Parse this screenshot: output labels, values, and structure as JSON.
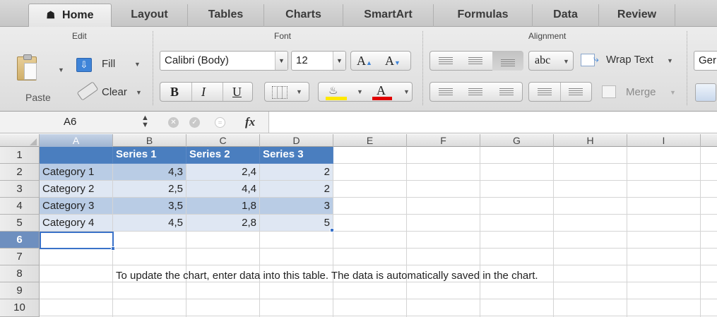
{
  "tabs": [
    {
      "label": "Home",
      "active": true
    },
    {
      "label": "Layout"
    },
    {
      "label": "Tables"
    },
    {
      "label": "Charts"
    },
    {
      "label": "SmartArt"
    },
    {
      "label": "Formulas"
    },
    {
      "label": "Data"
    },
    {
      "label": "Review"
    }
  ],
  "ribbon": {
    "groups": {
      "edit": "Edit",
      "font": "Font",
      "alignment": "Alignment"
    },
    "paste": "Paste",
    "fill": "Fill",
    "clear": "Clear",
    "font_name": "Calibri (Body)",
    "font_size": "12",
    "bold": "B",
    "italic": "I",
    "underline": "U",
    "grow_font": "A",
    "shrink_font": "A",
    "font_color_glyph": "A",
    "orientation": "abc",
    "wrap_text": "Wrap Text",
    "merge": "Merge",
    "number_format_partial": "Ger",
    "colors": {
      "highlight": "#ffe800",
      "font_color": "#e00000",
      "accent": "#3f84d8"
    }
  },
  "formula_bar": {
    "name_box": "A6",
    "fx": "fx",
    "content": ""
  },
  "columns": [
    "A",
    "B",
    "C",
    "D",
    "E",
    "F",
    "G",
    "H",
    "I"
  ],
  "rows": [
    "1",
    "2",
    "3",
    "4",
    "5",
    "6",
    "7",
    "8",
    "9",
    "10"
  ],
  "table": {
    "headers": [
      "",
      "Series 1",
      "Series 2",
      "Series 3"
    ],
    "rows": [
      [
        "Category 1",
        "4,3",
        "2,4",
        "2"
      ],
      [
        "Category 2",
        "2,5",
        "4,4",
        "2"
      ],
      [
        "Category 3",
        "3,5",
        "1,8",
        "3"
      ],
      [
        "Category 4",
        "4,5",
        "2,8",
        "5"
      ]
    ]
  },
  "note": "To update the chart, enter data into this table. The data is automatically saved in the chart."
}
